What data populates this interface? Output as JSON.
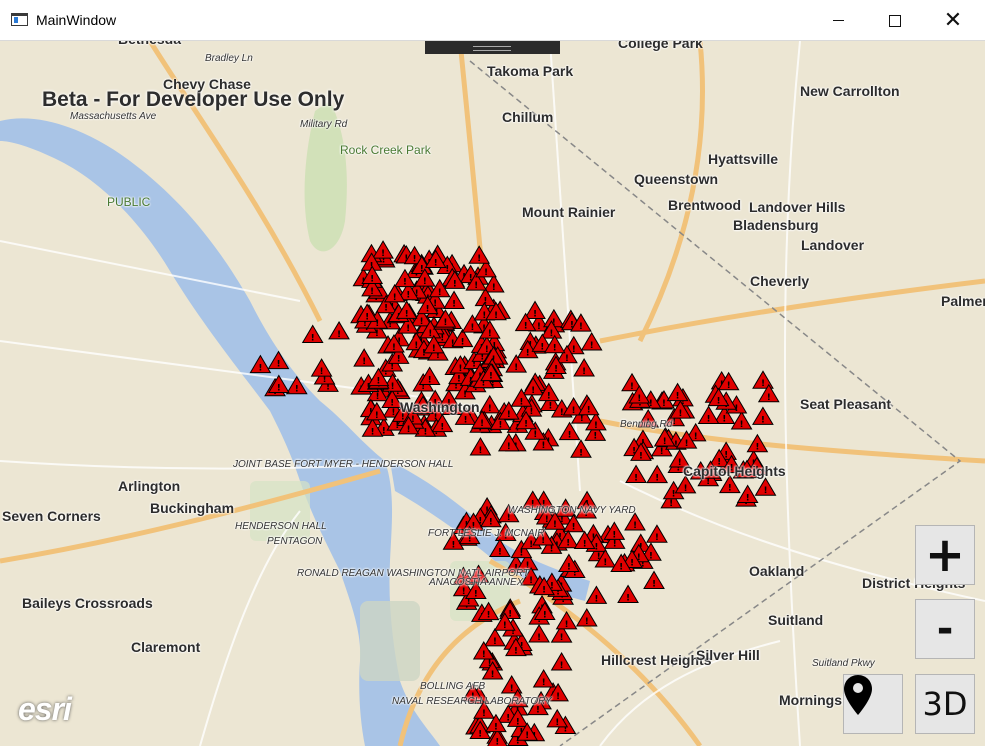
{
  "window": {
    "title": "MainWindow",
    "minimize": "",
    "maximize": "",
    "close": "✕"
  },
  "map": {
    "banner": "Beta - For Developer Use Only",
    "attribution": "esri",
    "places": [
      {
        "label": "Bethesda",
        "cls": ""
      },
      {
        "label": "Bradley Ln",
        "cls": "small"
      },
      {
        "label": "Chevy Chase",
        "cls": ""
      },
      {
        "label": "Takoma Park",
        "cls": ""
      },
      {
        "label": "College Park",
        "cls": ""
      },
      {
        "label": "New Carrollton",
        "cls": ""
      },
      {
        "label": "Chillum",
        "cls": ""
      },
      {
        "label": "Hyattsville",
        "cls": ""
      },
      {
        "label": "Queenstown",
        "cls": ""
      },
      {
        "label": "Mount Rainier",
        "cls": ""
      },
      {
        "label": "Brentwood",
        "cls": ""
      },
      {
        "label": "Landover Hills",
        "cls": ""
      },
      {
        "label": "Bladensburg",
        "cls": ""
      },
      {
        "label": "Landover",
        "cls": ""
      },
      {
        "label": "Cheverly",
        "cls": ""
      },
      {
        "label": "Palmer",
        "cls": ""
      },
      {
        "label": "Seat Pleasant",
        "cls": ""
      },
      {
        "label": "Capitol Heights",
        "cls": ""
      },
      {
        "label": "Arlington",
        "cls": ""
      },
      {
        "label": "Buckingham",
        "cls": ""
      },
      {
        "label": "Seven Corners",
        "cls": ""
      },
      {
        "label": "Baileys Crossroads",
        "cls": ""
      },
      {
        "label": "Claremont",
        "cls": ""
      },
      {
        "label": "Oakland",
        "cls": ""
      },
      {
        "label": "District Heights",
        "cls": ""
      },
      {
        "label": "Suitland",
        "cls": ""
      },
      {
        "label": "Hillcrest Heights",
        "cls": ""
      },
      {
        "label": "Silver Hill",
        "cls": ""
      },
      {
        "label": "Morningside",
        "cls": ""
      },
      {
        "label": "PUBLIC",
        "cls": "green"
      },
      {
        "label": "Rock Creek Park",
        "cls": "green"
      },
      {
        "label": "JOINT BASE FORT MYER - HENDERSON HALL",
        "cls": "small"
      },
      {
        "label": "HENDERSON HALL",
        "cls": "small"
      },
      {
        "label": "PENTAGON",
        "cls": "small"
      },
      {
        "label": "RONALD REAGAN WASHINGTON NATL AIRPORT",
        "cls": "small"
      },
      {
        "label": "ANACOSTIA ANNEX",
        "cls": "small"
      },
      {
        "label": "FORT LESLIE J. MCNAIR",
        "cls": "small"
      },
      {
        "label": "WASHINGTON NAVY YARD",
        "cls": "small"
      },
      {
        "label": "BOLLING AFB",
        "cls": "small"
      },
      {
        "label": "NAVAL RESEARCH LABORATORY",
        "cls": "small"
      },
      {
        "label": "Washington",
        "cls": ""
      },
      {
        "label": "Military Rd",
        "cls": "small"
      },
      {
        "label": "Massachusetts Ave",
        "cls": "small"
      },
      {
        "label": "Benning Rd",
        "cls": "small"
      },
      {
        "label": "Suitland Pkwy",
        "cls": "small"
      }
    ],
    "marker_count": 420,
    "marker_color": "#e00000",
    "controls": {
      "zoom_in": "+",
      "zoom_out": "-",
      "locate_icon": "map-pin-icon",
      "three_d": "3D"
    }
  }
}
